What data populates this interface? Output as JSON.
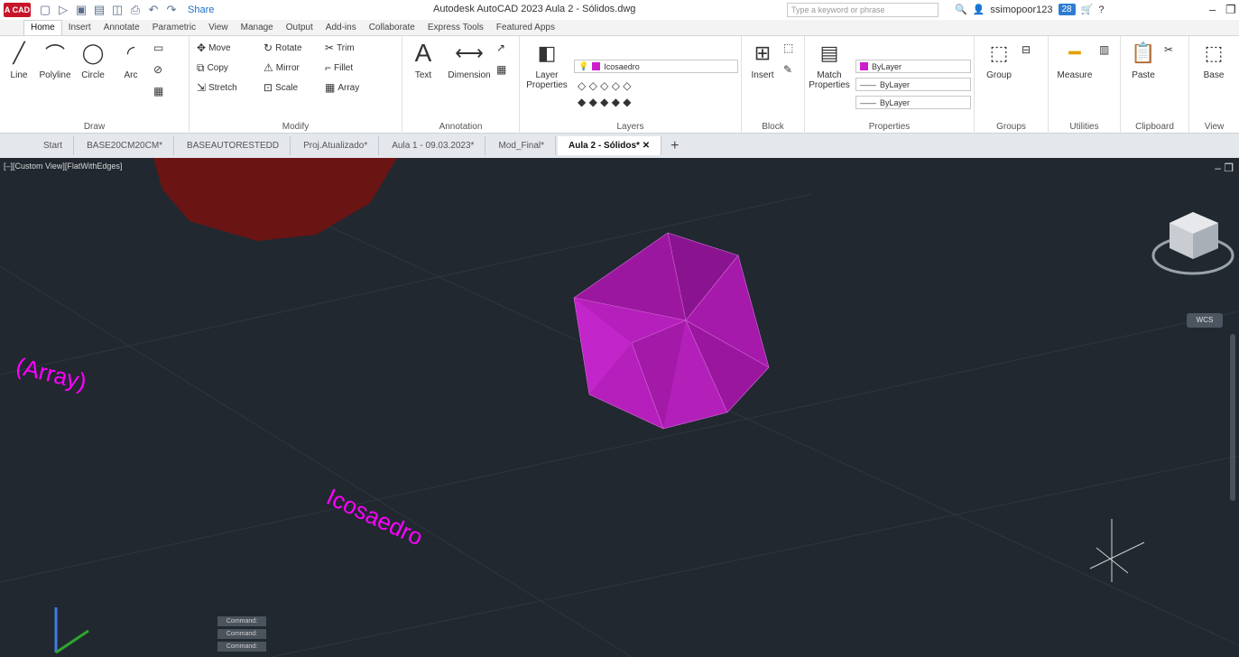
{
  "title_bar": {
    "logo": "A CAD",
    "share": "Share",
    "app_title": "Autodesk AutoCAD 2023   Aula 2 - Sólidos.dwg",
    "search_placeholder": "Type a keyword or phrase",
    "username": "ssimopoor123",
    "timer": "28"
  },
  "ribbon_tabs": [
    "Home",
    "Insert",
    "Annotate",
    "Parametric",
    "View",
    "Manage",
    "Output",
    "Add-ins",
    "Collaborate",
    "Express Tools",
    "Featured Apps"
  ],
  "panels": {
    "draw": {
      "title": "Draw",
      "line": "Line",
      "polyline": "Polyline",
      "circle": "Circle",
      "arc": "Arc"
    },
    "modify": {
      "title": "Modify",
      "move": "Move",
      "copy": "Copy",
      "stretch": "Stretch",
      "rotate": "Rotate",
      "mirror": "Mirror",
      "scale": "Scale",
      "trim": "Trim",
      "fillet": "Fillet",
      "array": "Array"
    },
    "annotation": {
      "title": "Annotation",
      "text": "Text",
      "dimension": "Dimension"
    },
    "layers": {
      "title": "Layers",
      "layer_properties": "Layer Properties",
      "current_layer": "Icosaedro"
    },
    "block": {
      "title": "Block",
      "insert": "Insert"
    },
    "properties": {
      "title": "Properties",
      "match": "Match Properties",
      "color": "ByLayer",
      "linetype": "ByLayer",
      "lineweight": "ByLayer"
    },
    "groups": {
      "title": "Groups",
      "group": "Group"
    },
    "utilities": {
      "title": "Utilities",
      "measure": "Measure"
    },
    "clipboard": {
      "title": "Clipboard",
      "paste": "Paste"
    },
    "view": {
      "title": "View",
      "base": "Base"
    }
  },
  "document_tabs": [
    "Start",
    "BASE20CM20CM*",
    "BASEAUTORESTEDD",
    "Proj.Atualizado*",
    "Aula 1 - 09.03.2023*",
    "Mod_Final*",
    "Aula 2 - Sólidos*"
  ],
  "viewport": {
    "label": "[–][Custom View][FlatWithEdges]",
    "text_array": "(Array)",
    "text_icosa": "Icosaedro",
    "wcs": "WCS",
    "commands": [
      "Command:",
      "Command:",
      "Command:"
    ]
  },
  "colors": {
    "solid": "#b01fb8",
    "text": "#ff00ff",
    "background": "#212830"
  }
}
